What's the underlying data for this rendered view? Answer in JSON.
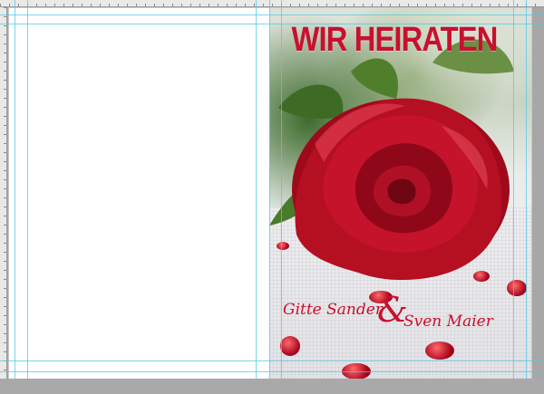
{
  "card": {
    "title": "WIR HEIRATEN",
    "name_left": "Gitte Sander",
    "ampersand": "&",
    "name_right": "Sven Maier"
  },
  "colors": {
    "title_red": "#c8102e",
    "rose_red": "#b00d1f",
    "guide_cyan": "#50c8e6",
    "workspace_gray": "#a7a7a7"
  }
}
